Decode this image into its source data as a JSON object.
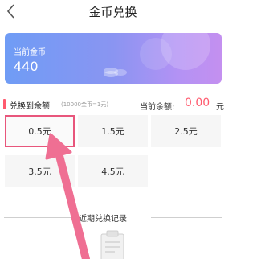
{
  "header": {
    "title": "金币兑换"
  },
  "card": {
    "label": "当前金币",
    "value": "440"
  },
  "exchange": {
    "label": "兑换到余额",
    "rate": "(10000金币=1元)",
    "balance_label": "当前余额:",
    "balance_value": "0.00",
    "balance_unit": "元"
  },
  "options": [
    "0.5元",
    "1.5元",
    "2.5元",
    "3.5元",
    "4.5元"
  ],
  "selected_option": "0.5元",
  "records": {
    "title": "近期兑换记录"
  },
  "colors": {
    "accent": "#ff5a6e",
    "selection_border": "#e8567c",
    "arrow": "#ef6f93"
  }
}
